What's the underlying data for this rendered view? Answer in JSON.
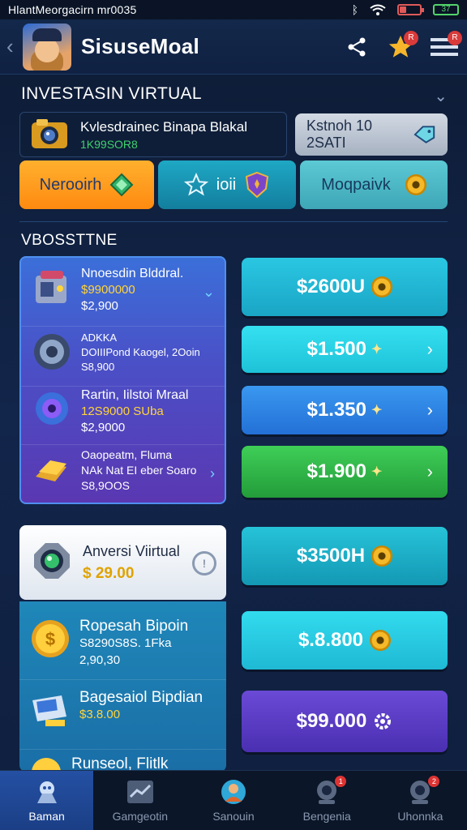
{
  "status_bar": {
    "text": "HlantMeorgacirn mr0035",
    "battery_text": "37"
  },
  "header": {
    "title": "SisuseMoal",
    "notif_badge": "R",
    "menu_badge": "R"
  },
  "section1": {
    "title": "INVESTASIN VIRTUAL",
    "card": {
      "title": "Kvlesdrainec Binapa Blakal",
      "subtitle": "1K99SOR8"
    },
    "grey_button": "Kstnoh 10 2SATI",
    "pills": [
      {
        "label": "Nerooirh"
      },
      {
        "label": "ioii"
      },
      {
        "label": "Moqpaivk"
      }
    ]
  },
  "section2": {
    "title": "VBOSSTTNE",
    "group1": [
      {
        "name": "Nnoesdin Blddral.",
        "line2": "$9900000",
        "line3": "$2,900"
      },
      {
        "name": "ADKKA",
        "line2": "DOIIIPond Kaogel, 2Ooin",
        "line3": "S8,900"
      },
      {
        "name": "Rartin, Iilstoi Mraal",
        "line2": "12S9000 SUba",
        "line3": "$2,9000"
      },
      {
        "name": "Oaopeatm, Fluma",
        "line2": "NAk Nat EI eber Soaro",
        "line3": "S8,9OOS"
      }
    ],
    "prices_top": [
      {
        "label": "$2600U",
        "color": "#21b7d3"
      },
      {
        "label": "$1.500",
        "color": "#23d2e6"
      },
      {
        "label": "$1.350",
        "color": "#2d86e6"
      },
      {
        "label": "$1.900",
        "color": "#2fb84a"
      }
    ],
    "white_card": {
      "name": "Anversi Viirtual",
      "price": "$ 29.00",
      "info": "!"
    },
    "group2": [
      {
        "name": "Ropesah Bipoin",
        "line2": "S8290S8S. 1Fka",
        "line3": "2,90,30"
      },
      {
        "name": "Bagesaiol Bipdian",
        "line2": "$3.8.00",
        "line3": ""
      },
      {
        "name": "Runseol, Flitlk",
        "line2": "",
        "line3": ""
      }
    ],
    "prices_bottom": [
      {
        "label": "$3500H",
        "color": "#20b4c9"
      },
      {
        "label": "$.8.800",
        "color": "#24cfe3"
      },
      {
        "label": "$99.000",
        "color": "#5b3bc6"
      }
    ]
  },
  "bottom_nav": [
    {
      "label": "Baman",
      "active": true
    },
    {
      "label": "Gamgeotin",
      "active": false
    },
    {
      "label": "Sanouin",
      "active": false
    },
    {
      "label": "Bengenia",
      "active": false,
      "badge": "1"
    },
    {
      "label": "Uhonnka",
      "active": false,
      "badge": "2"
    }
  ]
}
